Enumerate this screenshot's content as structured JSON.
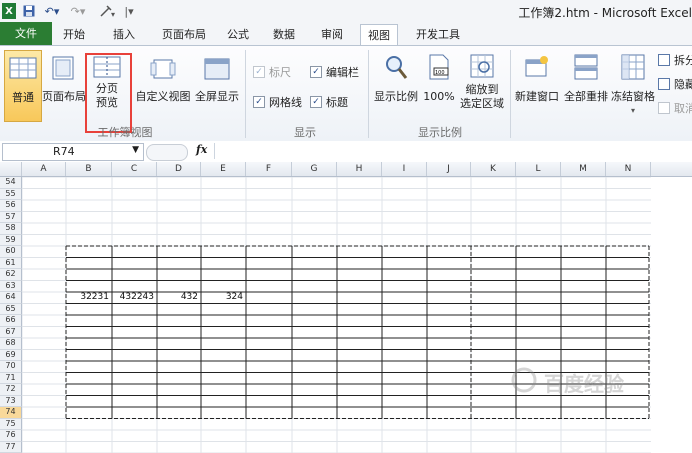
{
  "title_bar": {
    "title": "工作簿2.htm - Microsoft Excel",
    "app_icon": "excel-logo"
  },
  "tabs": [
    {
      "label": "文件"
    },
    {
      "label": "开始"
    },
    {
      "label": "插入"
    },
    {
      "label": "页面布局"
    },
    {
      "label": "公式"
    },
    {
      "label": "数据"
    },
    {
      "label": "审阅"
    },
    {
      "label": "视图"
    },
    {
      "label": "开发工具"
    }
  ],
  "ribbon": {
    "workbook_views": {
      "label": "工作簿视图",
      "normal": "普通",
      "page_layout": "页面布局",
      "page_break_line1": "分页",
      "page_break_line2": "预览",
      "custom_views": "自定义视图",
      "full_screen": "全屏显示"
    },
    "show": {
      "label": "显示",
      "ruler": "标尺",
      "formula_bar": "编辑栏",
      "gridlines": "网格线",
      "headings": "标题"
    },
    "zoom": {
      "label": "显示比例",
      "zoom": "显示比例",
      "hundred": "100%",
      "zoom_sel_line1": "缩放到",
      "zoom_sel_line2": "选定区域"
    },
    "window": {
      "new_window": "新建窗口",
      "arrange_all": "全部重排",
      "freeze_panes": "冻结窗格",
      "split": "拆分",
      "hide": "隐藏",
      "unhide": "取消"
    },
    "highlight_color": "#e8413a"
  },
  "formula_bar": {
    "name_box": "R74",
    "fx": "fx",
    "formula": ""
  },
  "grid": {
    "columns": [
      "A",
      "B",
      "C",
      "D",
      "E",
      "F",
      "G",
      "H",
      "I",
      "J",
      "K",
      "L",
      "M",
      "N"
    ],
    "rows": [
      "54",
      "55",
      "56",
      "57",
      "58",
      "59",
      "60",
      "61",
      "62",
      "63",
      "64",
      "65",
      "66",
      "67",
      "68",
      "69",
      "70",
      "71",
      "72",
      "73",
      "74",
      "75",
      "76",
      "77"
    ],
    "selected_row": "74",
    "values": [
      {
        "cell": "B64",
        "value": "32231"
      },
      {
        "cell": "C64",
        "value": "432243"
      },
      {
        "cell": "D64",
        "value": "432"
      },
      {
        "cell": "E64",
        "value": "324"
      }
    ]
  },
  "watermark": "百度经验"
}
